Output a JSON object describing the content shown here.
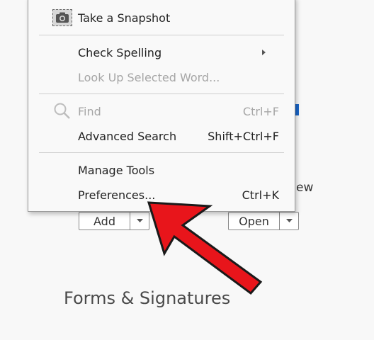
{
  "background": {
    "partial_label": "ew",
    "add_button": {
      "label": "Add"
    },
    "open_button": {
      "label": "Open"
    },
    "section_title": "Forms & Signatures"
  },
  "menu": {
    "items": [
      {
        "label": "Take a Snapshot",
        "icon": "camera-icon"
      },
      {
        "label": "Check Spelling",
        "submenu": true
      },
      {
        "label": "Look Up Selected Word...",
        "disabled": true
      },
      {
        "label": "Find",
        "shortcut": "Ctrl+F",
        "disabled": true,
        "icon": "search-icon"
      },
      {
        "label": "Advanced Search",
        "shortcut": "Shift+Ctrl+F"
      },
      {
        "label": "Manage Tools"
      },
      {
        "label": "Preferences...",
        "shortcut": "Ctrl+K"
      }
    ]
  },
  "annotation": {
    "arrow_color": "#e8151b",
    "points_to": "Preferences..."
  }
}
